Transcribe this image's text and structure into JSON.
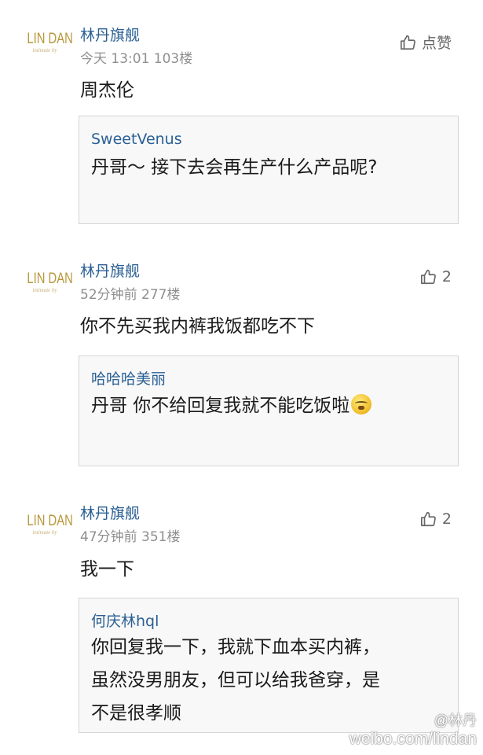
{
  "comments": [
    {
      "avatar": {
        "logo_main": "LIN DAN",
        "logo_sub": "intimate by"
      },
      "user": "林丹旗舰",
      "meta": "今天 13:01 103楼",
      "like_label": "点赞",
      "text": "周杰伦",
      "quote": {
        "user": "SweetVenus",
        "text": "丹哥～ 接下去会再生产什么产品呢?"
      }
    },
    {
      "avatar": {
        "logo_main": "LIN DAN",
        "logo_sub": "intimate by"
      },
      "user": "林丹旗舰",
      "meta": "52分钟前 277楼",
      "like_label": "2",
      "text": "你不先买我内裤我饭都吃不下",
      "quote": {
        "user": "哈哈哈美丽",
        "text": "丹哥 你不给回复我就不能吃饭啦"
      }
    },
    {
      "avatar": {
        "logo_main": "LIN DAN",
        "logo_sub": "intimate by"
      },
      "user": "林丹旗舰",
      "meta": "47分钟前 351楼",
      "like_label": "2",
      "text": "我一下",
      "quote": {
        "user": "何庆林hql",
        "lines": [
          "你回复我一下，我就下血本买内裤，",
          "虽然没男朋友，但可以给我爸穿，是",
          "不是很孝顺"
        ]
      }
    }
  ],
  "watermark": {
    "handle": "@林丹",
    "url": "weibo.com/lindan"
  }
}
